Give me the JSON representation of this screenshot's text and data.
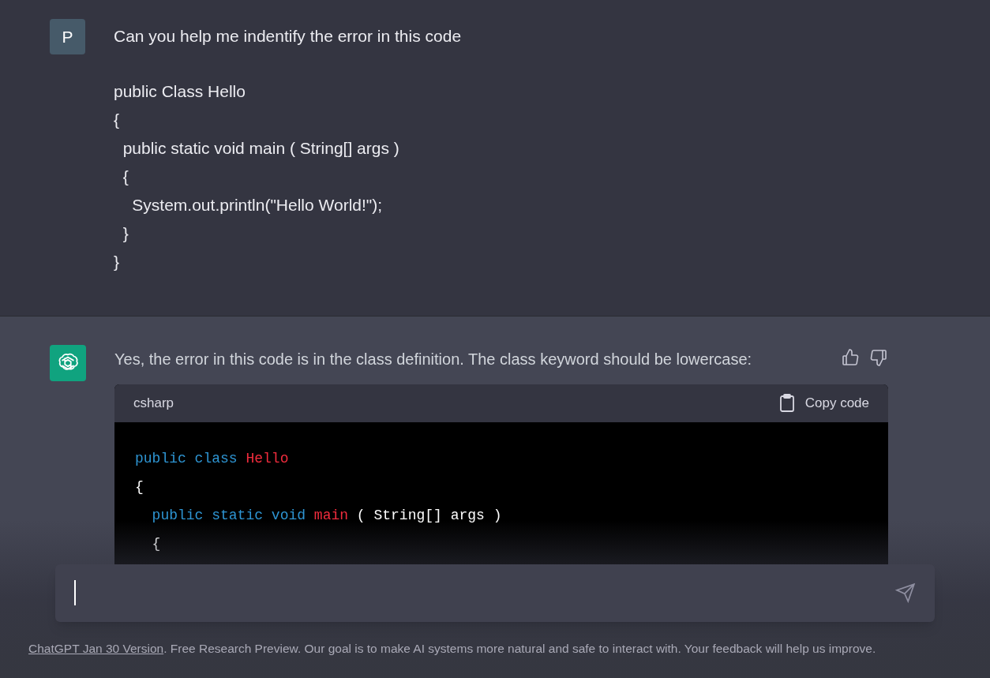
{
  "messages": [
    {
      "kind": "user",
      "avatar": "P",
      "paragraphs": [
        [
          "Can you help me indentify the error in this code"
        ],
        [
          "public Class Hello",
          "{",
          "  public static void main ( String[] args )",
          "  {",
          "    System.out.println(\"Hello World!\");",
          "  }",
          "}"
        ]
      ]
    },
    {
      "kind": "assistant",
      "text": "Yes, the error in this code is in the class definition. The class keyword should be lowercase:",
      "code": {
        "language": "csharp",
        "copy_label": "Copy code",
        "lines": [
          [
            {
              "kind": "keyword",
              "text": "public class"
            },
            {
              "kind": "name",
              "text": " Hello"
            }
          ],
          [
            {
              "kind": "plain",
              "text": "{"
            }
          ],
          [
            {
              "kind": "keyword",
              "text": "  public static void"
            },
            {
              "kind": "name",
              "text": " main"
            },
            {
              "kind": "plain",
              "text": " ( String[] args )"
            }
          ],
          [
            {
              "kind": "plain",
              "text": "  {"
            }
          ]
        ]
      }
    }
  ],
  "footer": {
    "link": "ChatGPT Jan 30 Version",
    "text": ". Free Research Preview. Our goal is to make AI systems more natural and safe to interact with. Your feedback will help us improve."
  }
}
